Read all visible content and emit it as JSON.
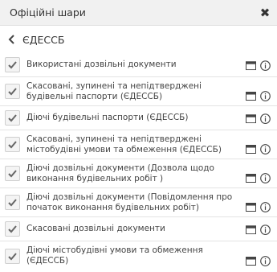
{
  "header": {
    "title": "Офіційні шари",
    "close_symbol": "✖"
  },
  "back": {
    "label": "ЄДЕССБ"
  },
  "layers": [
    {
      "label": "Використані дозвільні документи",
      "checked": true
    },
    {
      "label": "Скасовані, зупинені та непідтверджені будівельні паспорти (ЄДЕССБ)",
      "checked": true
    },
    {
      "label": "Діючі будівельні паспорти (ЄДЕССБ)",
      "checked": true
    },
    {
      "label": "Скасовані, зупинені та непідтверджені містобудівні умови та обмеження (ЄДЕССБ)",
      "checked": true
    },
    {
      "label": "Діючі дозвільні документи (Дозвола щодо виконання будівельних робіт )",
      "checked": true
    },
    {
      "label": "Діючі дозвільні документи (Повідомлення про початок виконання будівельних робіт)",
      "checked": true
    },
    {
      "label": "Скасовані дозвільні документи",
      "checked": true
    },
    {
      "label": "Діючі містобудівні умови та обмеження (ЄДЕССБ)",
      "checked": true
    }
  ]
}
